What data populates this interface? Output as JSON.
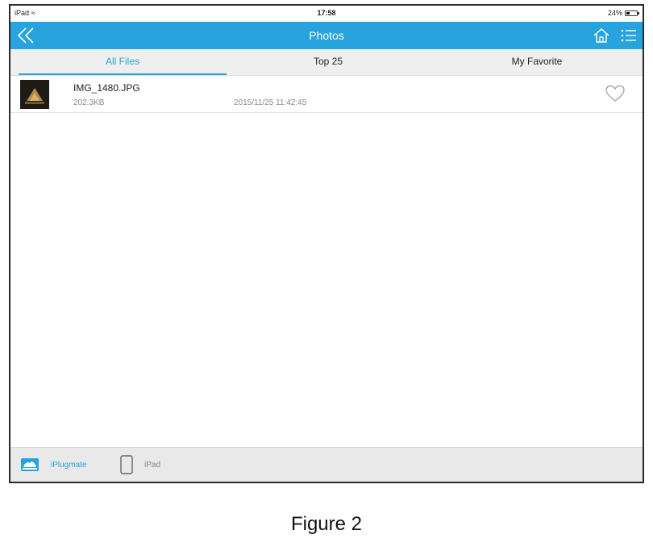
{
  "status_bar": {
    "device": "iPad",
    "time": "17:58",
    "battery": "24%"
  },
  "nav": {
    "title": "Photos",
    "back_icon": "double-chevron-left-icon",
    "home_icon": "home-icon",
    "menu_icon": "list-menu-icon"
  },
  "tabs": [
    {
      "label": "All Files",
      "active": true
    },
    {
      "label": "Top 25",
      "active": false
    },
    {
      "label": "My Favorite",
      "active": false
    }
  ],
  "files": [
    {
      "name": "IMG_1480.JPG",
      "size": "202.3KB",
      "date": "2015/11/25 11:42:45",
      "favorite": false
    }
  ],
  "footer": {
    "devices": [
      {
        "label": "iPlugmate",
        "icon": "drive-icon",
        "active": true
      },
      {
        "label": "iPad",
        "icon": "tablet-icon",
        "active": false
      }
    ]
  },
  "caption": "Figure 2",
  "colors": {
    "accent": "#27a3de",
    "nav_bg": "#27a3de",
    "tab_bg": "#efefef",
    "footer_bg": "#e9e9e9"
  }
}
